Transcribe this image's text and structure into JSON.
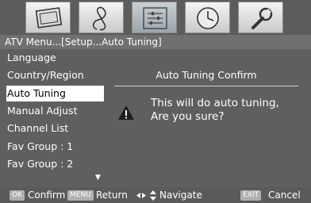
{
  "tabs": [
    {
      "icon": "picture-icon"
    },
    {
      "icon": "sound-icon"
    },
    {
      "icon": "setup-icon"
    },
    {
      "icon": "clock-icon"
    },
    {
      "icon": "tools-icon"
    }
  ],
  "active_tab_index": 2,
  "breadcrumb": "ATV Menu...[Setup...Auto Tuning]",
  "sidebar": {
    "items": [
      {
        "label": "Language"
      },
      {
        "label": "Country/Region"
      },
      {
        "label": "Auto Tuning"
      },
      {
        "label": "Manual Adjust"
      },
      {
        "label": "Channel List"
      },
      {
        "label": "Fav Group : 1"
      },
      {
        "label": "Fav Group : 2"
      }
    ],
    "selected_index": 2
  },
  "dialog": {
    "title": "Auto Tuning Confirm",
    "line1": "This will do auto tuning,",
    "line2": "Are you sure?"
  },
  "footer": {
    "ok_key": "OK",
    "ok_label": "Confirm",
    "menu_key": "MENU",
    "menu_label": "Return",
    "nav_label": "Navigate",
    "exit_key": "EXIT",
    "exit_label": "Cancel"
  },
  "colors": {
    "background": "#5f5f5f",
    "selected_item_bg": "#ffffff",
    "key_badge_bg": "#b0b0b0"
  }
}
